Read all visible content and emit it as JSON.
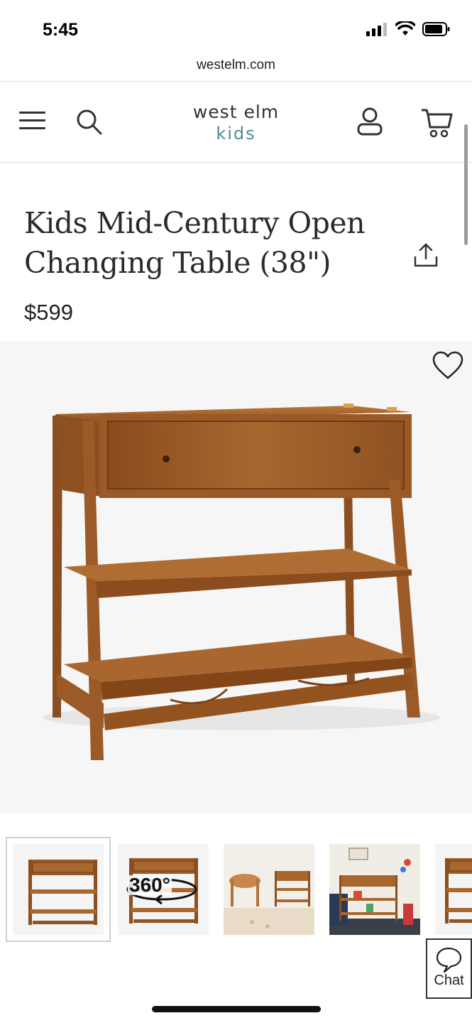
{
  "status_bar": {
    "time": "5:45"
  },
  "browser": {
    "url": "westelm.com"
  },
  "header": {
    "brand_main": "west elm",
    "brand_sub": "kids"
  },
  "product": {
    "title_line1": "Kids Mid-Century Open",
    "title_line2": "Changing Table (38\")",
    "price": "$599"
  },
  "thumbnails": [
    {
      "label": "",
      "selected": true,
      "icon": "changing-table-front"
    },
    {
      "label": "360°",
      "selected": false,
      "icon": "rotate-360"
    },
    {
      "label": "",
      "selected": false,
      "icon": "room-scene-bassinet"
    },
    {
      "label": "",
      "selected": false,
      "icon": "room-scene-toys"
    },
    {
      "label": "",
      "selected": false,
      "icon": "changing-table-partial"
    }
  ],
  "chat": {
    "label": "Chat"
  },
  "colors": {
    "wood": "#9a5a2a",
    "wood_dark": "#7a4218",
    "brand_kids": "#4e8a9c"
  }
}
